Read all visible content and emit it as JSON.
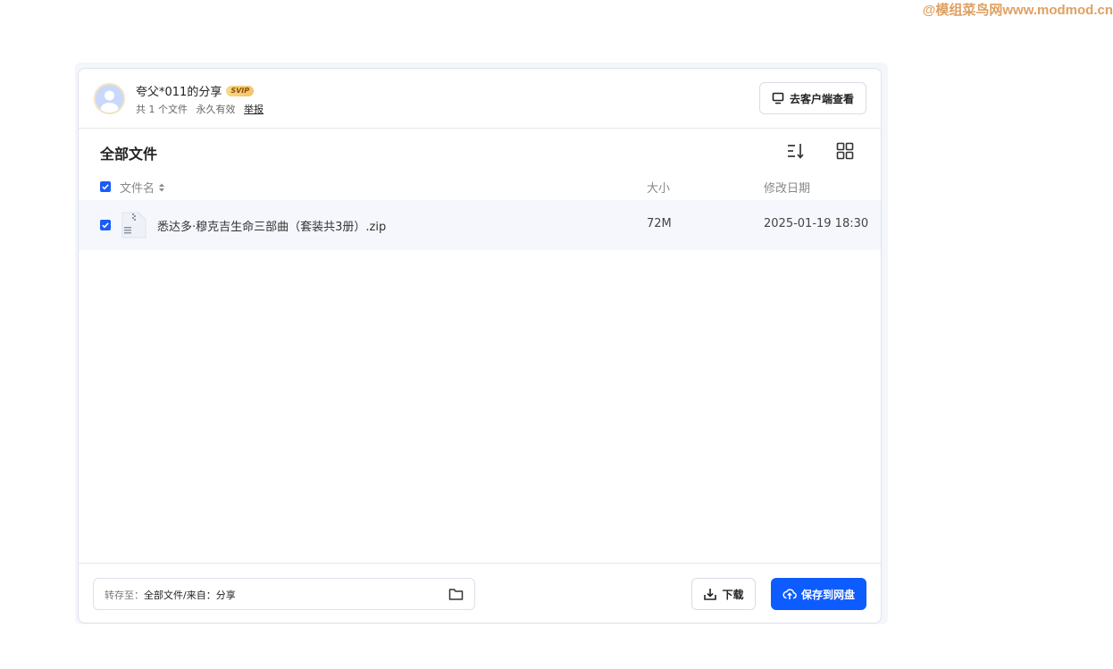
{
  "watermark": "@模组菜鸟网www.modmod.cn",
  "share": {
    "title": "夸父*011的分享",
    "badge": "SVIP",
    "file_count": "共 1 个文件",
    "validity": "永久有效",
    "report": "举报",
    "client_button": "去客户端查看"
  },
  "toolbar": {
    "title": "全部文件",
    "sort_icon": "sort-icon",
    "grid_icon": "grid-view-icon"
  },
  "table": {
    "columns": {
      "name": "文件名",
      "size": "大小",
      "date": "修改日期"
    },
    "rows": [
      {
        "name": "悉达多·穆克吉生命三部曲（套装共3册）.zip",
        "size": "72M",
        "date": "2025-01-19 18:30",
        "checked": true
      }
    ]
  },
  "footer": {
    "dest_label": "转存至：",
    "dest_value": "全部文件/来自：分享",
    "download_button": "下载",
    "save_button": "保存到网盘"
  },
  "colors": {
    "primary": "#0d5cff",
    "checkbox": "#1a5cf5",
    "row_highlight": "#f5f7fd",
    "badge": "#f3c369"
  }
}
